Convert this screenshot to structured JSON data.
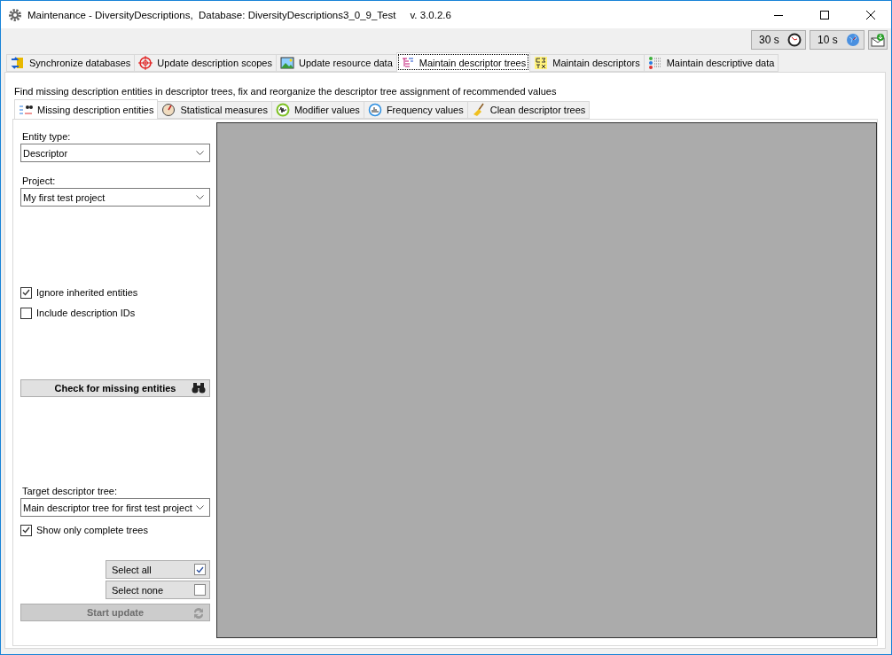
{
  "window": {
    "title": "Maintenance - DiversityDescriptions,  Database: DiversityDescriptions3_0_9_Test",
    "version": "v. 3.0.2.6"
  },
  "timers": [
    {
      "label": "30 s",
      "kind": "clock"
    },
    {
      "label": "10 s",
      "kind": "globe"
    }
  ],
  "tabs": [
    {
      "label": "Synchronize databases",
      "kind": "sync",
      "selected": false
    },
    {
      "label": "Update description scopes",
      "kind": "target",
      "selected": false
    },
    {
      "label": "Update resource data",
      "kind": "image",
      "selected": false
    },
    {
      "label": "Maintain descriptor trees",
      "kind": "tree",
      "selected": true
    },
    {
      "label": "Maintain descriptors",
      "kind": "symbols",
      "selected": false
    },
    {
      "label": "Maintain descriptive data",
      "kind": "list",
      "selected": false
    }
  ],
  "description": "Find missing description entities in descriptor trees, fix and reorganize the descriptor tree assignment of recommended values",
  "sub_tabs": [
    {
      "label": "Missing description entities",
      "kind": "binoculars",
      "selected": true
    },
    {
      "label": "Statistical measures",
      "kind": "compass",
      "selected": false
    },
    {
      "label": "Modifier values",
      "kind": "wave",
      "selected": false
    },
    {
      "label": "Frequency values",
      "kind": "bars",
      "selected": false
    },
    {
      "label": "Clean descriptor trees",
      "kind": "broom",
      "selected": false
    }
  ],
  "entity_type": {
    "label": "Entity type:",
    "value": "Descriptor"
  },
  "project": {
    "label": "Project:",
    "value": "My first test project"
  },
  "options": [
    {
      "label": "Ignore inherited entities",
      "checked": true
    },
    {
      "label": "Include description IDs",
      "checked": false
    }
  ],
  "check_button": {
    "label": "Check for missing entities"
  },
  "target_tree": {
    "label": "Target descriptor tree:",
    "value": "Main descriptor tree for first test project"
  },
  "show_complete": {
    "label": "Show only complete trees",
    "checked": true
  },
  "select_buttons": [
    {
      "label": "Select all",
      "checked": true
    },
    {
      "label": "Select none",
      "checked": false
    }
  ],
  "start_button": {
    "label": "Start update",
    "disabled": true
  }
}
